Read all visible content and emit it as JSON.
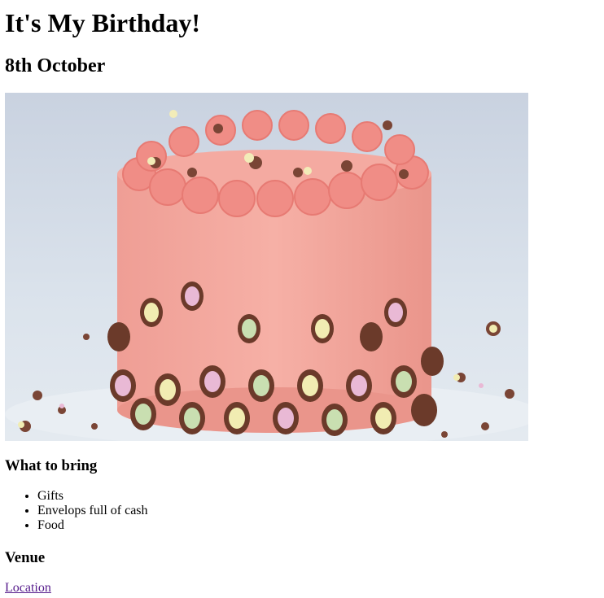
{
  "page": {
    "title": "It's My Birthday!",
    "date": "8th October"
  },
  "image": {
    "description_name": "birthday-cake-photo"
  },
  "bring": {
    "heading": "What to bring",
    "items": [
      "Gifts",
      "Envelops full of cash",
      "Food"
    ]
  },
  "venue": {
    "heading": "Venue",
    "link_label": "Location"
  },
  "colors": {
    "visited_link": "#551a8b",
    "frosting": "#f2a29a",
    "chocolate": "#6b3a2a",
    "background": "#dfe6ee"
  }
}
